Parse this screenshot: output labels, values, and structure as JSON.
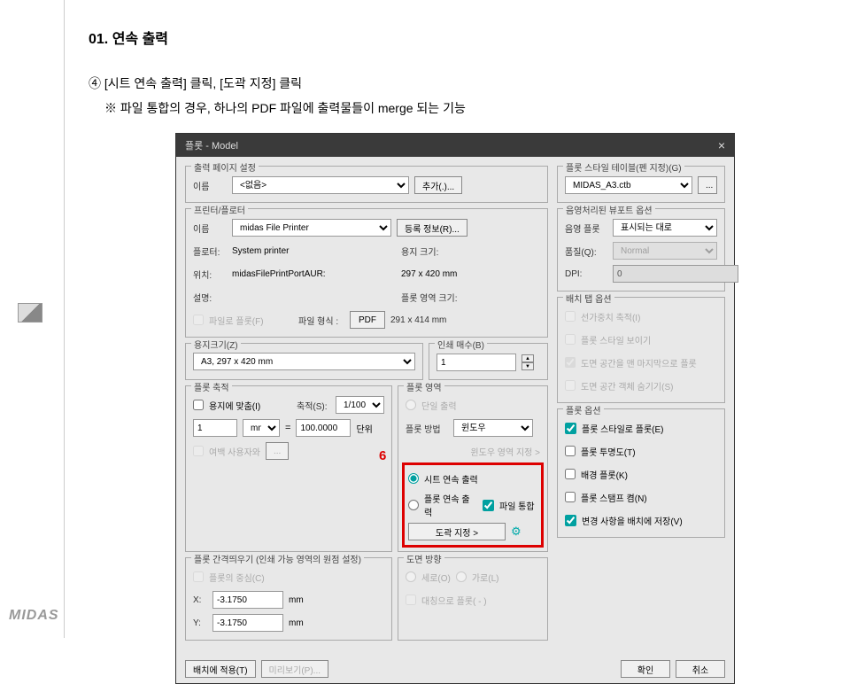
{
  "doc": {
    "title": "01. 연속 출력",
    "step": "④ [시트 연속 출력] 클릭, [도곽 지정] 클릭",
    "note": "※ 파일 통합의 경우, 하나의 PDF 파일에 출력물들이 merge 되는 기능",
    "logo": "MIDAS"
  },
  "dlg": {
    "title": "플롯 - Model",
    "close": "×"
  },
  "pageset": {
    "title": "출력 페이지 설정",
    "name_lbl": "이름",
    "name_val": "<없음>",
    "add_btn": "추가(.)..."
  },
  "printer": {
    "title": "프린터/플로터",
    "name_lbl": "이름",
    "name_val": "midas File Printer",
    "reg_btn": "등록 정보(R)...",
    "plotter_lbl": "플로터:",
    "plotter_val": "System printer",
    "loc_lbl": "위치:",
    "loc_val": "midasFilePrintPortAUR:",
    "desc_lbl": "설명:",
    "file_chk": "파일로 플롯(F)",
    "format_lbl": "파일 형식 :",
    "format_val": "PDF",
    "paper_lbl": "용지 크기:",
    "paper_val": "297 x 420 mm",
    "area_lbl": "플롯 영역 크기:",
    "area_val": "291 x 414 mm"
  },
  "paper": {
    "title": "용지크기(Z)",
    "val": "A3, 297 x 420 mm"
  },
  "copies": {
    "title": "인쇄 매수(B)",
    "val": "1"
  },
  "scale": {
    "title": "플롯 축적",
    "fit_chk": "용지에 맞춤(I)",
    "scale_lbl": "축적(S):",
    "scale_val": "1/100",
    "num": "1",
    "unit": "mm",
    "eq": "=",
    "denom": "100.0000",
    "unit2": "단위",
    "margin": "여백 사용자와",
    "dots": "..."
  },
  "plotarea": {
    "title": "플롯 영역",
    "single": "단일 출력",
    "method_lbl": "플롯 방법",
    "method_val": "윈도우",
    "win_btn": "윈도우 영역 지정 >",
    "sheet": "시트 연속 출력",
    "plot_seq": "플롯 연속 출력",
    "merge": "파일 통합",
    "frame_btn": "도곽 지정 >",
    "gear": "⚙",
    "num": "6"
  },
  "offset": {
    "title": "플롯 간격띄우기 (인쇄 가능 영역의 원점 설정)",
    "center": "플롯의 중심(C)",
    "x_lbl": "X:",
    "x_val": "-3.1750",
    "y_lbl": "Y:",
    "y_val": "-3.1750",
    "mm": "mm"
  },
  "orient": {
    "title": "도면 방향",
    "portrait": "세로(O)",
    "landscape": "가로(L)",
    "upside": "대칭으로 플롯( - )"
  },
  "styletable": {
    "title": "플롯 스타일 테이블(펜 지정)(G)",
    "val": "MIDAS_A3.ctb",
    "dots": "..."
  },
  "viewport": {
    "title": "음영처리된 뷰포트 옵션",
    "shade_lbl": "음영 플롯",
    "shade_val": "표시되는 대로",
    "qual_lbl": "품질(Q):",
    "qual_val": "Normal",
    "dpi_lbl": "DPI:",
    "dpi_val": "0"
  },
  "layout": {
    "title": "배치 탭 옵션",
    "o1": "선가중치 축적(I)",
    "o2": "플롯 스타일 보이기",
    "o3": "도면 공간을 맨 마지막으로 플롯",
    "o4": "도면 공간 객체 숨기기(S)"
  },
  "plotopt": {
    "title": "플롯 옵션",
    "o1": "플롯 스타일로 플롯(E)",
    "o2": "플롯 투명도(T)",
    "o3": "배경 플롯(K)",
    "o4": "플롯 스탬프 켬(N)",
    "o5": "변경 사항을 배치에 저장(V)"
  },
  "foot": {
    "apply": "배치에 적용(T)",
    "preview": "미리보기(P)...",
    "ok": "확인",
    "cancel": "취소"
  }
}
